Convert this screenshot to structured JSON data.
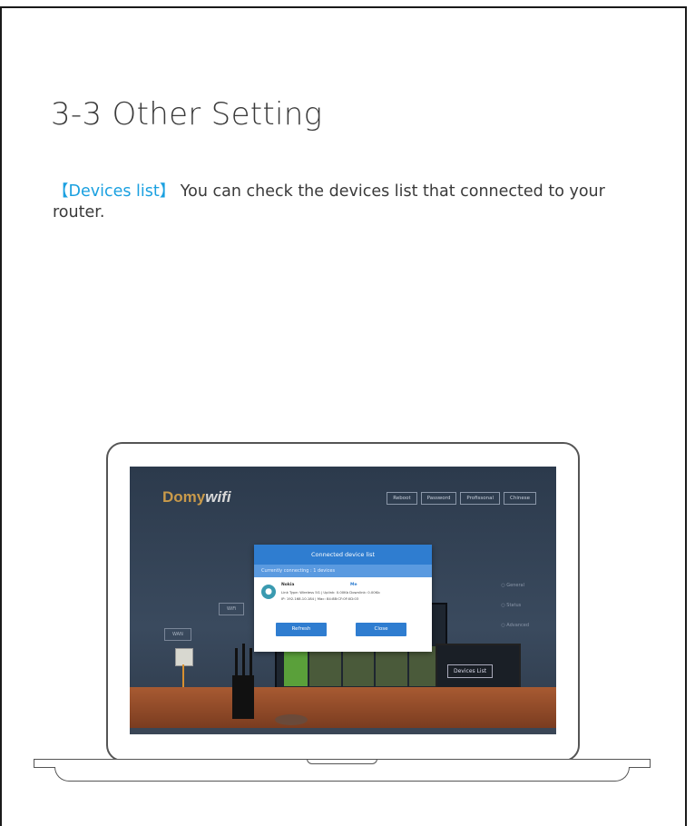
{
  "heading": "3-3 Other Setting",
  "intro": {
    "tag": "【Devices list】",
    "text": " You can check the devices list that connected to your router."
  },
  "screen": {
    "logo": "Domy",
    "logo_wifi": "wifi",
    "nav": [
      "Reboot",
      "Password",
      "Profissonal",
      "Chinese"
    ],
    "side_menu": [
      "General",
      "Status",
      "Advanced"
    ],
    "wall_labels": [
      "WAN",
      "WiFi"
    ],
    "device_button": "Devices List",
    "modal": {
      "title": "Connected device list",
      "subtitle": "Currently connecting : 1 devices",
      "device_name": "Nokia",
      "device_tag": "Me",
      "line1": "Link Type: Wireless 5G  |  Uplink: 0.00Kb  Downlink: 0.00Kb",
      "line2": "IP: 192.168.10.184  |  Mac: 84:8B:CF:0F:0D:03",
      "refresh": "Refresh",
      "close": "Close"
    }
  },
  "colors": {
    "accent": "#1aa0e0",
    "modal_blue": "#2f7dd0",
    "text": "#3a3a3a"
  }
}
